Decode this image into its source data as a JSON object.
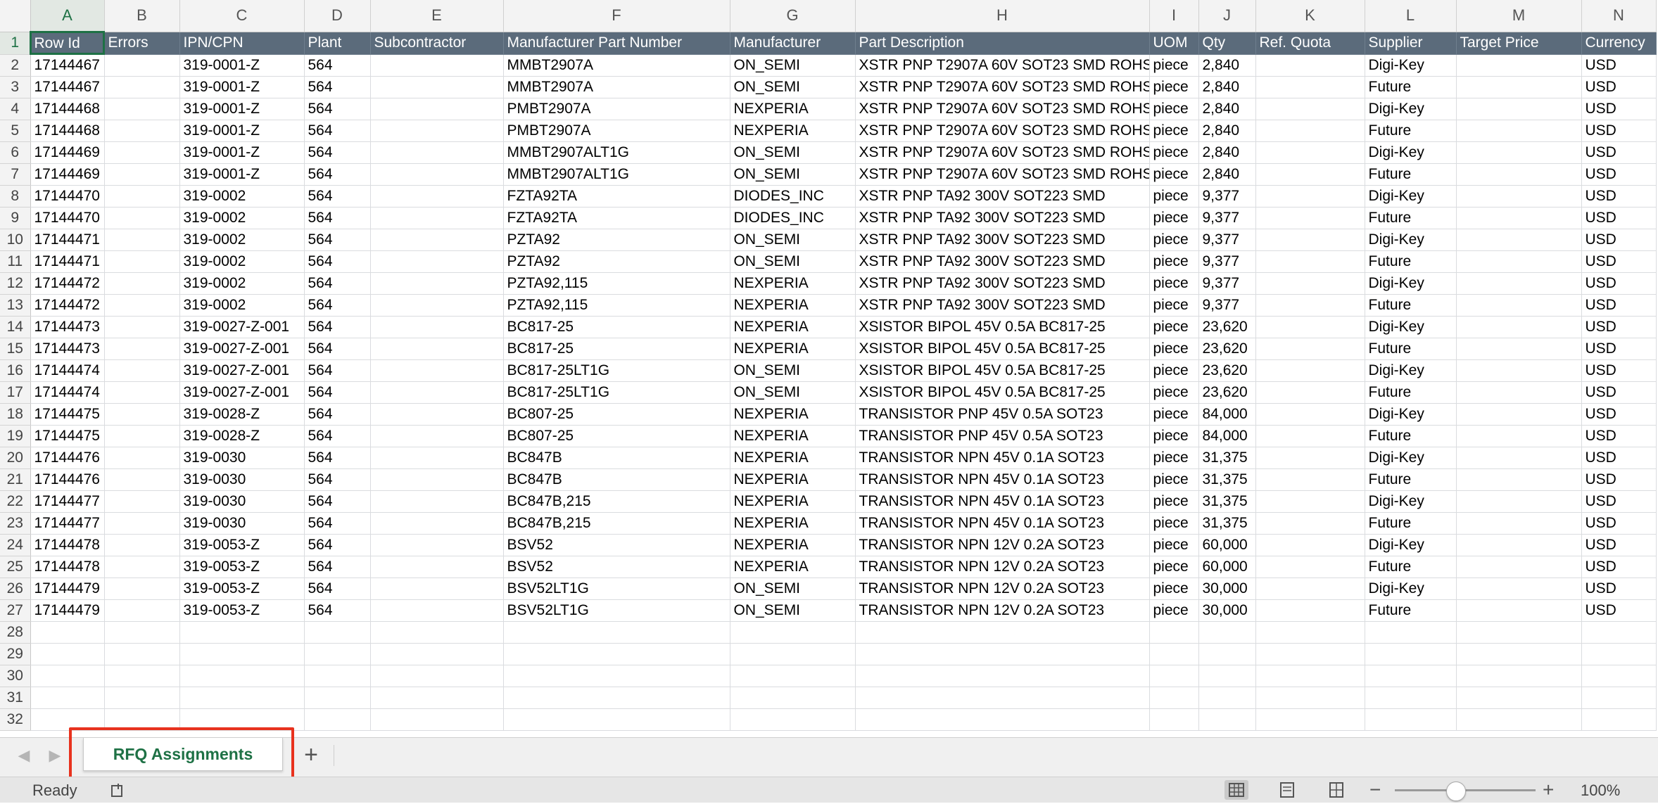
{
  "columns": [
    {
      "letter": "A"
    },
    {
      "letter": "B"
    },
    {
      "letter": "C"
    },
    {
      "letter": "D"
    },
    {
      "letter": "E"
    },
    {
      "letter": "F"
    },
    {
      "letter": "G"
    },
    {
      "letter": "H"
    },
    {
      "letter": "I"
    },
    {
      "letter": "J"
    },
    {
      "letter": "K"
    },
    {
      "letter": "L"
    },
    {
      "letter": "M"
    },
    {
      "letter": "N"
    }
  ],
  "selected_cell": "A1",
  "header_row": [
    "Row Id",
    "Errors",
    "IPN/CPN",
    "Plant",
    "Subcontractor",
    "Manufacturer Part Number",
    "Manufacturer",
    "Part Description",
    "UOM",
    "Qty",
    "Ref. Quota",
    "Supplier",
    "Target Price",
    "Currency"
  ],
  "rows": [
    [
      "17144467",
      "",
      "319-0001-Z",
      "564",
      "",
      "MMBT2907A",
      "ON_SEMI",
      "XSTR PNP T2907A 60V SOT23 SMD ROHS",
      "piece",
      "2,840",
      "",
      "Digi-Key",
      "",
      "USD"
    ],
    [
      "17144467",
      "",
      "319-0001-Z",
      "564",
      "",
      "MMBT2907A",
      "ON_SEMI",
      "XSTR PNP T2907A 60V SOT23 SMD ROHS",
      "piece",
      "2,840",
      "",
      "Future",
      "",
      "USD"
    ],
    [
      "17144468",
      "",
      "319-0001-Z",
      "564",
      "",
      "PMBT2907A",
      "NEXPERIA",
      "XSTR PNP T2907A 60V SOT23 SMD ROHS",
      "piece",
      "2,840",
      "",
      "Digi-Key",
      "",
      "USD"
    ],
    [
      "17144468",
      "",
      "319-0001-Z",
      "564",
      "",
      "PMBT2907A",
      "NEXPERIA",
      "XSTR PNP T2907A 60V SOT23 SMD ROHS",
      "piece",
      "2,840",
      "",
      "Future",
      "",
      "USD"
    ],
    [
      "17144469",
      "",
      "319-0001-Z",
      "564",
      "",
      "MMBT2907ALT1G",
      "ON_SEMI",
      "XSTR PNP T2907A 60V SOT23 SMD ROHS",
      "piece",
      "2,840",
      "",
      "Digi-Key",
      "",
      "USD"
    ],
    [
      "17144469",
      "",
      "319-0001-Z",
      "564",
      "",
      "MMBT2907ALT1G",
      "ON_SEMI",
      "XSTR PNP T2907A 60V SOT23 SMD ROHS",
      "piece",
      "2,840",
      "",
      "Future",
      "",
      "USD"
    ],
    [
      "17144470",
      "",
      "319-0002",
      "564",
      "",
      "FZTA92TA",
      "DIODES_INC",
      "XSTR PNP TA92 300V SOT223 SMD",
      "piece",
      "9,377",
      "",
      "Digi-Key",
      "",
      "USD"
    ],
    [
      "17144470",
      "",
      "319-0002",
      "564",
      "",
      "FZTA92TA",
      "DIODES_INC",
      "XSTR PNP TA92 300V SOT223 SMD",
      "piece",
      "9,377",
      "",
      "Future",
      "",
      "USD"
    ],
    [
      "17144471",
      "",
      "319-0002",
      "564",
      "",
      "PZTA92",
      "ON_SEMI",
      "XSTR PNP TA92 300V SOT223 SMD",
      "piece",
      "9,377",
      "",
      "Digi-Key",
      "",
      "USD"
    ],
    [
      "17144471",
      "",
      "319-0002",
      "564",
      "",
      "PZTA92",
      "ON_SEMI",
      "XSTR PNP TA92 300V SOT223 SMD",
      "piece",
      "9,377",
      "",
      "Future",
      "",
      "USD"
    ],
    [
      "17144472",
      "",
      "319-0002",
      "564",
      "",
      "PZTA92,115",
      "NEXPERIA",
      "XSTR PNP TA92 300V SOT223 SMD",
      "piece",
      "9,377",
      "",
      "Digi-Key",
      "",
      "USD"
    ],
    [
      "17144472",
      "",
      "319-0002",
      "564",
      "",
      "PZTA92,115",
      "NEXPERIA",
      "XSTR PNP TA92 300V SOT223 SMD",
      "piece",
      "9,377",
      "",
      "Future",
      "",
      "USD"
    ],
    [
      "17144473",
      "",
      "319-0027-Z-001",
      "564",
      "",
      "BC817-25",
      "NEXPERIA",
      "XSISTOR BIPOL 45V 0.5A BC817-25",
      "piece",
      "23,620",
      "",
      "Digi-Key",
      "",
      "USD"
    ],
    [
      "17144473",
      "",
      "319-0027-Z-001",
      "564",
      "",
      "BC817-25",
      "NEXPERIA",
      "XSISTOR BIPOL 45V 0.5A BC817-25",
      "piece",
      "23,620",
      "",
      "Future",
      "",
      "USD"
    ],
    [
      "17144474",
      "",
      "319-0027-Z-001",
      "564",
      "",
      "BC817-25LT1G",
      "ON_SEMI",
      "XSISTOR BIPOL 45V 0.5A BC817-25",
      "piece",
      "23,620",
      "",
      "Digi-Key",
      "",
      "USD"
    ],
    [
      "17144474",
      "",
      "319-0027-Z-001",
      "564",
      "",
      "BC817-25LT1G",
      "ON_SEMI",
      "XSISTOR BIPOL 45V 0.5A BC817-25",
      "piece",
      "23,620",
      "",
      "Future",
      "",
      "USD"
    ],
    [
      "17144475",
      "",
      "319-0028-Z",
      "564",
      "",
      "BC807-25",
      "NEXPERIA",
      "TRANSISTOR PNP 45V 0.5A SOT23",
      "piece",
      "84,000",
      "",
      "Digi-Key",
      "",
      "USD"
    ],
    [
      "17144475",
      "",
      "319-0028-Z",
      "564",
      "",
      "BC807-25",
      "NEXPERIA",
      "TRANSISTOR PNP 45V 0.5A SOT23",
      "piece",
      "84,000",
      "",
      "Future",
      "",
      "USD"
    ],
    [
      "17144476",
      "",
      "319-0030",
      "564",
      "",
      "BC847B",
      "NEXPERIA",
      "TRANSISTOR NPN 45V 0.1A SOT23",
      "piece",
      "31,375",
      "",
      "Digi-Key",
      "",
      "USD"
    ],
    [
      "17144476",
      "",
      "319-0030",
      "564",
      "",
      "BC847B",
      "NEXPERIA",
      "TRANSISTOR NPN 45V 0.1A SOT23",
      "piece",
      "31,375",
      "",
      "Future",
      "",
      "USD"
    ],
    [
      "17144477",
      "",
      "319-0030",
      "564",
      "",
      "BC847B,215",
      "NEXPERIA",
      "TRANSISTOR NPN 45V 0.1A SOT23",
      "piece",
      "31,375",
      "",
      "Digi-Key",
      "",
      "USD"
    ],
    [
      "17144477",
      "",
      "319-0030",
      "564",
      "",
      "BC847B,215",
      "NEXPERIA",
      "TRANSISTOR NPN 45V 0.1A SOT23",
      "piece",
      "31,375",
      "",
      "Future",
      "",
      "USD"
    ],
    [
      "17144478",
      "",
      "319-0053-Z",
      "564",
      "",
      "BSV52",
      "NEXPERIA",
      "TRANSISTOR NPN 12V 0.2A SOT23",
      "piece",
      "60,000",
      "",
      "Digi-Key",
      "",
      "USD"
    ],
    [
      "17144478",
      "",
      "319-0053-Z",
      "564",
      "",
      "BSV52",
      "NEXPERIA",
      "TRANSISTOR NPN 12V 0.2A SOT23",
      "piece",
      "60,000",
      "",
      "Future",
      "",
      "USD"
    ],
    [
      "17144479",
      "",
      "319-0053-Z",
      "564",
      "",
      "BSV52LT1G",
      "ON_SEMI",
      "TRANSISTOR NPN 12V 0.2A SOT23",
      "piece",
      "30,000",
      "",
      "Digi-Key",
      "",
      "USD"
    ],
    [
      "17144479",
      "",
      "319-0053-Z",
      "564",
      "",
      "BSV52LT1G",
      "ON_SEMI",
      "TRANSISTOR NPN 12V 0.2A SOT23",
      "piece",
      "30,000",
      "",
      "Future",
      "",
      "USD"
    ]
  ],
  "row_numbers": [
    "1",
    "2",
    "3",
    "4",
    "5",
    "6",
    "7",
    "8",
    "9",
    "10",
    "11",
    "12",
    "13",
    "14",
    "15",
    "16",
    "17",
    "18",
    "19",
    "20",
    "21",
    "22",
    "23",
    "24",
    "25",
    "26",
    "27",
    "28",
    "29",
    "30",
    "31",
    "32"
  ],
  "tabs": {
    "sheet_name": "RFQ Assignments",
    "add_label": "+",
    "prev_icon": "◀",
    "next_icon": "▶"
  },
  "status": {
    "text": "Ready",
    "zoom_minus": "−",
    "zoom_plus": "+",
    "zoom_level": "100%",
    "zoom_fraction": 0.43
  },
  "colors": {
    "accent": "#1e7145",
    "header_fill": "#5b6b7b",
    "highlight": "#e8321e"
  }
}
